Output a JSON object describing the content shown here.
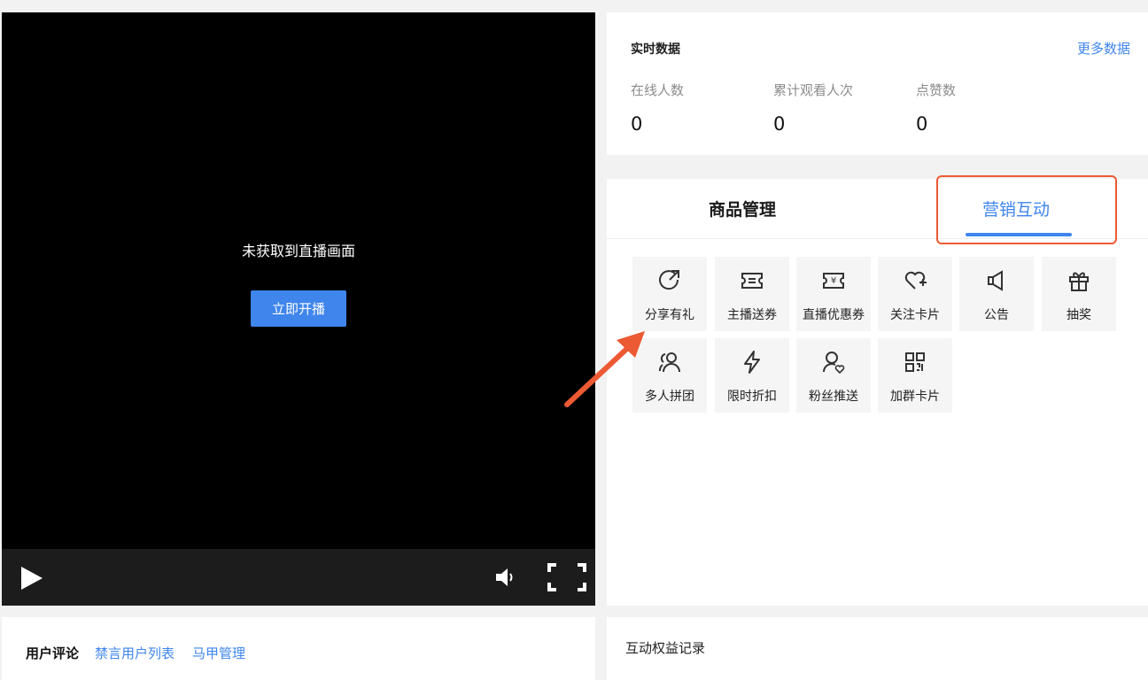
{
  "video": {
    "message": "未获取到直播画面",
    "start_button": "立即开播"
  },
  "stats": {
    "title": "实时数据",
    "more_link": "更多数据",
    "items": [
      {
        "label": "在线人数",
        "value": "0"
      },
      {
        "label": "累计观看人次",
        "value": "0"
      },
      {
        "label": "点赞数",
        "value": "0"
      }
    ]
  },
  "tabs": {
    "goods": "商品管理",
    "marketing": "营销互动",
    "active": "营销互动"
  },
  "tools": [
    {
      "label": "分享有礼",
      "icon": "share-arrow-icon"
    },
    {
      "label": "主播送券",
      "icon": "coupon-ticket-icon"
    },
    {
      "label": "直播优惠券",
      "icon": "yen-coupon-icon"
    },
    {
      "label": "关注卡片",
      "icon": "heart-plus-icon"
    },
    {
      "label": "公告",
      "icon": "megaphone-icon"
    },
    {
      "label": "抽奖",
      "icon": "gift-icon"
    },
    {
      "label": "多人拼团",
      "icon": "group-users-icon"
    },
    {
      "label": "限时折扣",
      "icon": "lightning-icon"
    },
    {
      "label": "粉丝推送",
      "icon": "fan-user-heart-icon"
    },
    {
      "label": "加群卡片",
      "icon": "qr-code-icon"
    }
  ],
  "comments": {
    "user_comments": "用户评论",
    "muted_list": "禁言用户列表",
    "alias_manage": "马甲管理"
  },
  "records": {
    "title": "互动权益记录"
  },
  "colors": {
    "accent": "#3f85ec",
    "highlight": "#ec5a34"
  }
}
